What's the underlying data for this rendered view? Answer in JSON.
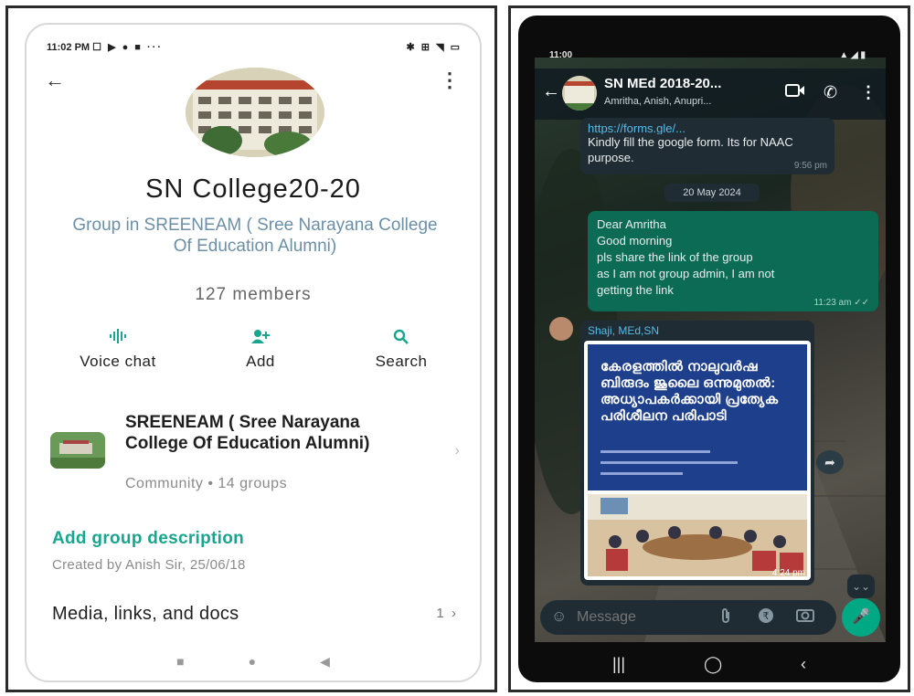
{
  "left": {
    "status_time": "11:02 PM",
    "status_icons": "☐ ▶ ● ■ ···",
    "status_right": "✱ ⊞ ◥ ▭",
    "title": "SN College20-20",
    "subtitle": "Group in SREENEAM ( Sree Narayana College Of Education Alumni)",
    "members": "127 members",
    "actions": [
      {
        "label": "Voice chat",
        "icon": "voice-wave-icon"
      },
      {
        "label": "Add",
        "icon": "add-person-icon"
      },
      {
        "label": "Search",
        "icon": "search-icon"
      }
    ],
    "community": {
      "name": "SREENEAM ( Sree Narayana College Of Education Alumni)",
      "meta": "Community • 14 groups"
    },
    "add_description": "Add group description",
    "created": "Created by Anish Sir, 25/06/18",
    "media_label": "Media, links, and docs",
    "media_count": "1"
  },
  "right": {
    "status_time": "11:00",
    "chat_name": "SN MEd 2018-20...",
    "chat_members": "Amritha, Anish, Anupri...",
    "top_message": {
      "text": "Kindly fill the google form. Its for NAAC purpose.",
      "time": "9:56 pm"
    },
    "date_chip": "20 May 2024",
    "out_message": {
      "lines": [
        "Dear Amritha",
        "Good morning",
        "pls share the link of the group",
        "as I am not group admin, I am not",
        "getting the link"
      ],
      "time": "11:23 am"
    },
    "image_message": {
      "sender": "Shaji, MEd,SN",
      "poster_title": "കേരളത്തിൽ നാലുവർഷ ബിരുദം ജൂലൈ ഒന്നുമുതൽ: അധ്യാപകർക്കായി പ്രത്യേക പരിശീലന പരിപാടി",
      "time": "4:24 pm"
    },
    "composer_placeholder": "Message"
  },
  "colors": {
    "whatsapp_teal": "#19a58e",
    "outgoing_bubble": "#0b6b54",
    "incoming_bubble": "#1f2c33",
    "link_blue": "#53bdeb",
    "poster_blue": "#1e3f8c"
  }
}
